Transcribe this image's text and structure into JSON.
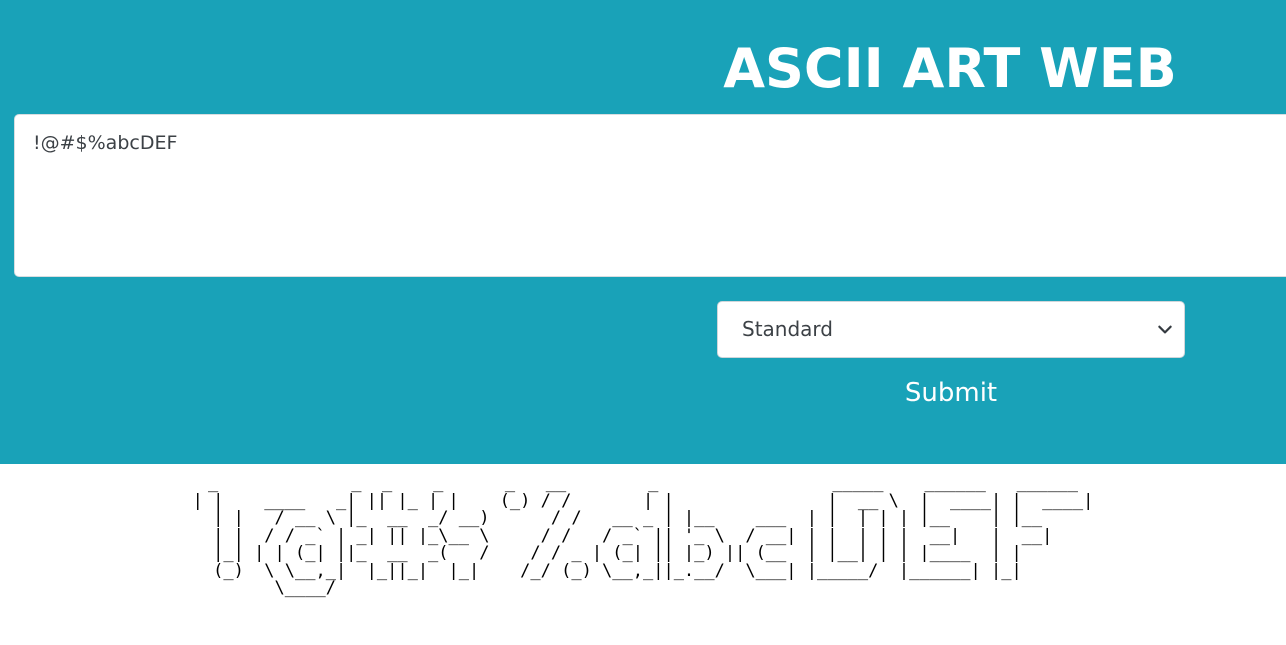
{
  "header": {
    "title": "ASCII ART WEB",
    "background_color": "#19a2b8"
  },
  "form": {
    "input_value": "!@#$%abcDEF",
    "font_select": {
      "selected": "Standard",
      "icon": "chevron-down-icon"
    },
    "submit_label": "Submit"
  },
  "output": {
    "ascii_art": " _             _  _    _      _   __        _                 _____    ______   ______ \n| |    ____   _| || |_ | |    (_) / /       | |               |  __ \\  |  ____| |  ____|\n| |   / __ \\ |_  __  _/ __)      / /   __ _ | |__    ___  | |  | | | |__    | |__   \n| |  / / _` | _| || |_\\__ \\     / /   / _` || '_ \\  / __| | |  | | |  __|   |  __|  \n|_| | | (_| ||_  __  _(   /    / / _ | (_| || |_) || (__  | |__| | | |____  | |     \n(_)  \\ \\__,_|  |_||_|  |_|    /_/ (_) \\__,_||_.__/  \\___| |_____/  |______| |_|     \n      \\____/                                                                        "
  }
}
